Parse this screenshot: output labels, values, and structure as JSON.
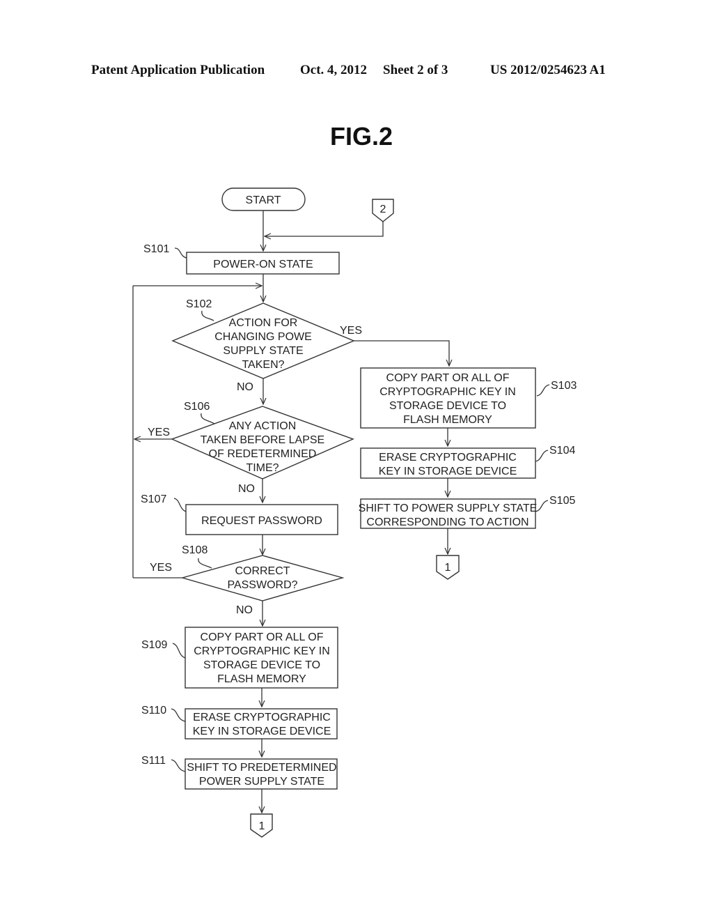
{
  "header": {
    "publication": "Patent Application Publication",
    "date": "Oct. 4, 2012",
    "sheet": "Sheet 2 of 3",
    "number": "US 2012/0254623 A1"
  },
  "figure": {
    "title": "FIG.2"
  },
  "nodes": {
    "start": {
      "label": "START"
    },
    "conn2_in": {
      "label": "2"
    },
    "s101": {
      "step": "S101",
      "lines": [
        "POWER-ON STATE"
      ]
    },
    "s102": {
      "step": "S102",
      "lines": [
        "ACTION FOR",
        "CHANGING POWE",
        "SUPPLY STATE",
        "TAKEN?"
      ]
    },
    "s103": {
      "step": "S103",
      "lines": [
        "COPY PART OR ALL OF",
        "CRYPTOGRAPHIC KEY IN",
        "STORAGE DEVICE TO",
        "FLASH MEMORY"
      ]
    },
    "s104": {
      "step": "S104",
      "lines": [
        "ERASE CRYPTOGRAPHIC",
        "KEY IN STORAGE DEVICE"
      ]
    },
    "s105": {
      "step": "S105",
      "lines": [
        "SHIFT TO POWER SUPPLY STATE",
        "CORRESPONDING TO ACTION"
      ]
    },
    "s106": {
      "step": "S106",
      "lines": [
        "ANY ACTION",
        "TAKEN BEFORE LAPSE",
        "OF REDETERMINED",
        "TIME?"
      ]
    },
    "s107": {
      "step": "S107",
      "lines": [
        "REQUEST PASSWORD"
      ]
    },
    "s108": {
      "step": "S108",
      "lines": [
        "CORRECT",
        "PASSWORD?"
      ]
    },
    "s109": {
      "step": "S109",
      "lines": [
        "COPY PART OR ALL OF",
        "CRYPTOGRAPHIC KEY IN",
        "STORAGE DEVICE TO",
        "FLASH MEMORY"
      ]
    },
    "s110": {
      "step": "S110",
      "lines": [
        "ERASE CRYPTOGRAPHIC",
        "KEY IN STORAGE DEVICE"
      ]
    },
    "s111": {
      "step": "S111",
      "lines": [
        "SHIFT TO PREDETERMINED",
        "POWER SUPPLY STATE"
      ]
    },
    "conn1_right": {
      "label": "1"
    },
    "conn1_left": {
      "label": "1"
    }
  },
  "edge_labels": {
    "s102_yes": "YES",
    "s102_no": "NO",
    "s106_yes": "YES",
    "s106_no": "NO",
    "s108_yes": "YES",
    "s108_no": "NO"
  }
}
